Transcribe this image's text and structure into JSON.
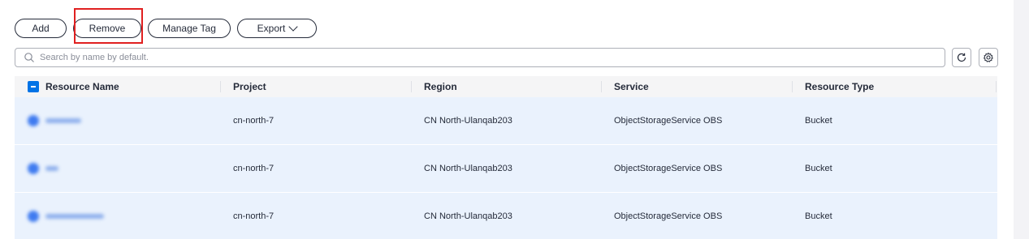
{
  "toolbar": {
    "add_label": "Add",
    "remove_label": "Remove",
    "manage_tag_label": "Manage Tag",
    "export_label": "Export"
  },
  "search": {
    "placeholder": "Search by name by default."
  },
  "table": {
    "columns": [
      "Resource Name",
      "Project",
      "Region",
      "Service",
      "Resource Type"
    ],
    "rows": [
      {
        "project": "cn-north-7",
        "region": "CN North-Ulanqab203",
        "service": "ObjectStorageService OBS",
        "type": "Bucket"
      },
      {
        "project": "cn-north-7",
        "region": "CN North-Ulanqab203",
        "service": "ObjectStorageService OBS",
        "type": "Bucket"
      },
      {
        "project": "cn-north-7",
        "region": "CN North-Ulanqab203",
        "service": "ObjectStorageService OBS",
        "type": "Bucket"
      }
    ]
  },
  "icons": {
    "search": "search-icon",
    "refresh": "refresh-icon",
    "settings": "gear-icon",
    "export_dropdown": "chevron-down-icon"
  },
  "colors": {
    "accent": "#0073e6",
    "highlight": "#e02020",
    "row_background": "#eaf2fd",
    "header_background": "#f5f5f6"
  }
}
